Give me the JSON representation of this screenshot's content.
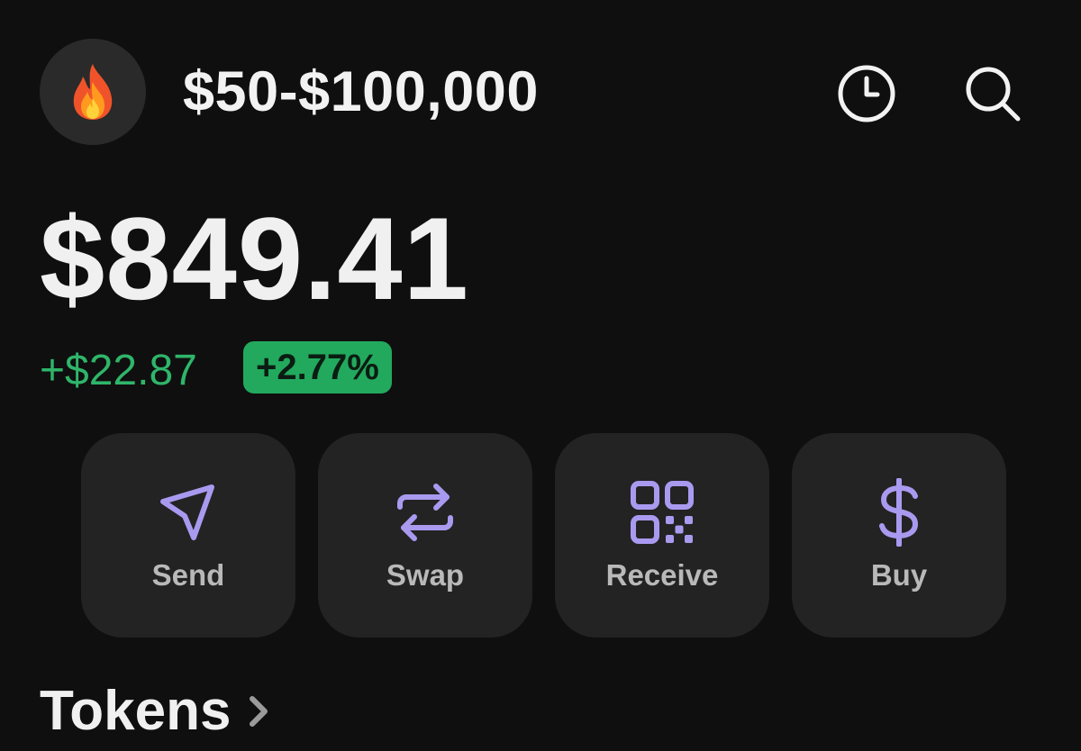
{
  "header": {
    "account_name": "$50-$100,000",
    "avatar_icon": "fire-emoji-icon",
    "history_icon": "clock-icon",
    "search_icon": "search-icon"
  },
  "portfolio": {
    "balance": "$849.41",
    "change_amount": "+$22.87",
    "change_percent": "+2.77%"
  },
  "actions": [
    {
      "label": "Send",
      "icon": "send-icon"
    },
    {
      "label": "Swap",
      "icon": "swap-icon"
    },
    {
      "label": "Receive",
      "icon": "qr-code-icon"
    },
    {
      "label": "Buy",
      "icon": "dollar-icon"
    }
  ],
  "tokens": {
    "title": "Tokens"
  },
  "colors": {
    "background": "#0f0f0f",
    "accent_purple": "#a99af0",
    "positive_green": "#2fb56a",
    "badge_green": "#22a95d",
    "card": "#232323"
  }
}
